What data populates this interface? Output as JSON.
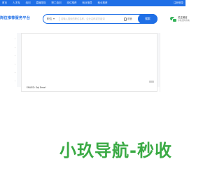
{
  "topbar": {
    "nav": [
      "首页",
      "人才库",
      "培训",
      "直播带岗",
      "职工培训",
      "岗位推荐",
      "就业指导",
      "就业推荐"
    ],
    "right_label": "注册登录"
  },
  "header": {
    "site_title": "岗位推荐服务平台",
    "search": {
      "type_label": "职位",
      "placeholder": "请输入搜索的职位名称、企业名称或关键词",
      "voice_label": "语音",
      "button_label": "搜索"
    },
    "wechat": {
      "title": "关注微信",
      "subtitle": "手机扫码查看"
    }
  },
  "ad": {
    "mark": "",
    "failed_text": "FAILED: Sql Error!"
  },
  "brand": {
    "text": "小玖导航-秒收"
  },
  "colors": {
    "accent": "#1f6fe6",
    "brand_green": "#3aaa44",
    "wechat_green": "#36b35a"
  }
}
